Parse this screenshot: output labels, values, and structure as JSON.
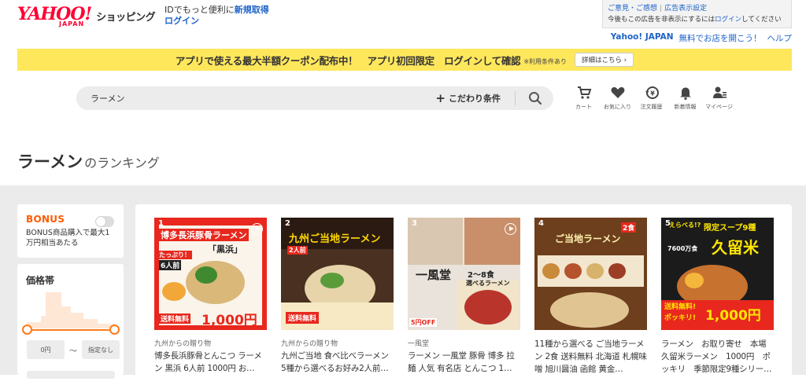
{
  "header": {
    "logo_main": "YAHOO!",
    "logo_sub": "JAPAN",
    "shop_name": "ショッピング",
    "id_text": "IDでもっと便利に",
    "register_link": "新規取得",
    "login_link": "ログイン"
  },
  "ad_box": {
    "feedback": "ご意見・ご感想",
    "ad_settings": "広告表示設定",
    "hide_text_before": "今後もこの広告を非表示にするには",
    "hide_link": "ログイン",
    "hide_text_after": "してください"
  },
  "top_links": {
    "yahoo_japan": "Yahoo! JAPAN",
    "open_shop": "無料でお店を開こう！",
    "help": "ヘルプ"
  },
  "banner": {
    "text": "アプリで使える最大半額クーポン配布中！　アプリ初回限定　ログインして確認",
    "note": "※利用条件あり",
    "button": "詳細はこちら ›"
  },
  "search": {
    "query": "ラーメン",
    "filter_label": "こだわり条件"
  },
  "nav": {
    "cart": "カート",
    "favorites": "お気に入り",
    "orders": "注文履歴",
    "news": "新着情報",
    "mypage": "マイページ"
  },
  "heading": {
    "keyword": "ラーメン",
    "suffix": "のランキング"
  },
  "sidebar": {
    "bonus_title": "BONUS",
    "bonus_text": "BONUS商品購入で最大1万円相当あたる",
    "price_title": "価格帯",
    "price_min": "0円",
    "price_sep": "〜",
    "price_max": "指定なし"
  },
  "products": [
    {
      "rank": "1",
      "store": "九州からの贈り物",
      "title": "博多長浜豚骨とんこつ ラーメン 黒浜 6人前 1000円 お…",
      "img_lines": [
        "博多長浜豚骨ラーメン",
        "「黒浜」",
        "たっぷり！",
        "6人前",
        "送料無料",
        "1,000円"
      ]
    },
    {
      "rank": "2",
      "store": "九州からの贈り物",
      "title": "九州ご当地 食べ比べラーメン 5種から選べるお好み2人前…",
      "img_lines": [
        "九州ご当地ラーメン",
        "2人前",
        "送料無料"
      ]
    },
    {
      "rank": "3",
      "store": "一風堂",
      "title": "ラーメン 一風堂 豚骨 博多 拉麺 人気 有名店 とんこつ 1…",
      "img_lines": [
        "一風堂",
        "2〜8食",
        "選べるラーメン",
        "5円OFF"
      ]
    },
    {
      "rank": "4",
      "store": "",
      "title": "11種から選べる ご当地ラーメン 2食 送料無料 北海道 札幌味噌 旭川醤油 函館 黄金…",
      "img_lines": [
        "ご当地ラーメン",
        "2食"
      ]
    },
    {
      "rank": "5",
      "store": "",
      "title": "ラーメン　お取り寄せ　本場久留米ラーメン　1000円　ポッキリ　季節限定9種シリー…",
      "img_lines": [
        "えらべる!?",
        "限定スープ9種",
        "7600万食",
        "久留米",
        "送料無料!",
        "ポッキリ!",
        "1,000円"
      ]
    }
  ],
  "colors": {
    "brand_red": "#ff0033",
    "banner_yellow": "#ffe75c",
    "link_blue": "#1e62c8",
    "bonus_orange": "#ff5a00",
    "slider_orange": "#ff7a1a"
  }
}
